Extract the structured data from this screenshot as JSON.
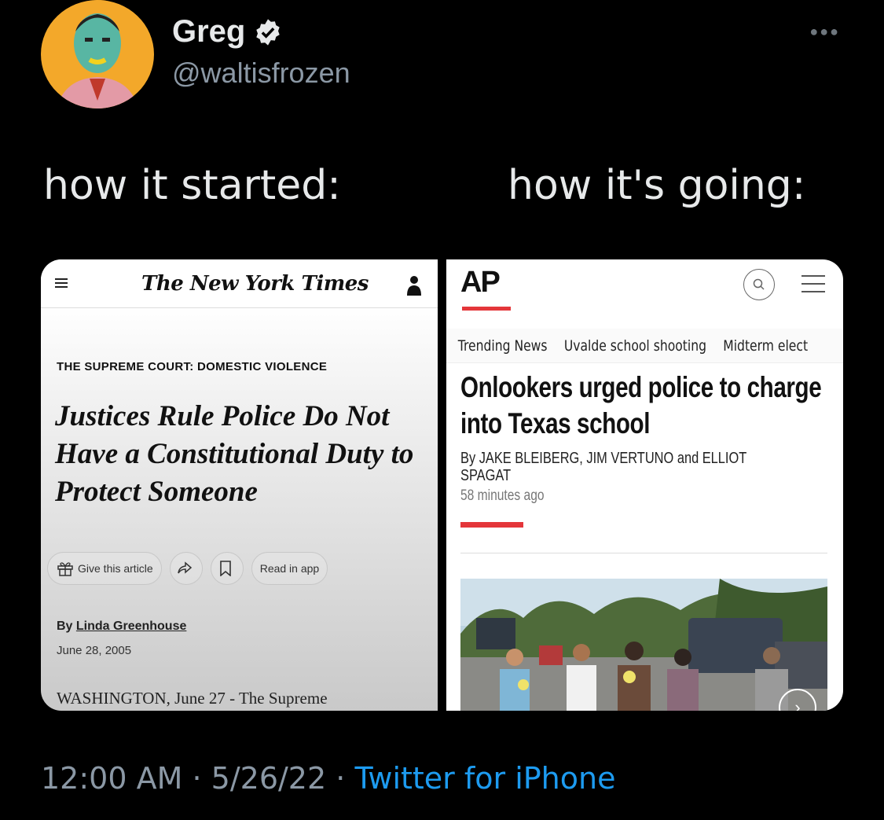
{
  "tweet": {
    "display_name": "Greg",
    "handle": "@waltisfrozen",
    "caption_left": "how it started:",
    "caption_right": "how it's going:",
    "time": "12:00 AM",
    "date": "5/26/22",
    "separator": "·",
    "source": "Twitter for iPhone"
  },
  "nyt": {
    "logo": "The New York Times",
    "kicker": "THE SUPREME COURT: DOMESTIC VIOLENCE",
    "headline": "Justices Rule Police Do Not Have a Constitutional Duty to Protect Someone",
    "give_label": "Give this article",
    "read_app_label": "Read in app",
    "byline_prefix": "By",
    "author": "Linda Greenhouse",
    "date": "June 28, 2005",
    "dateline": "WASHINGTON, June 27 - The Supreme"
  },
  "ap": {
    "logo": "AP",
    "nav": [
      "Trending News",
      "Uvalde school shooting",
      "Midterm elect"
    ],
    "headline": "Onlookers urged police to charge into Texas school",
    "byline": "By JAKE BLEIBERG, JIM VERTUNO and ELLIOT SPAGAT",
    "time": "58 minutes ago"
  },
  "colors": {
    "background": "#000000",
    "text": "#e7e9ea",
    "muted": "#8b98a5",
    "link": "#1d9bf0",
    "ap_red": "#e4363a"
  }
}
